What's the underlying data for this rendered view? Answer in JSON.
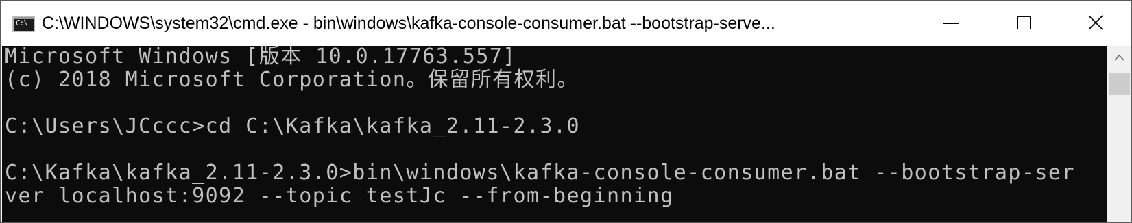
{
  "window": {
    "title": "C:\\WINDOWS\\system32\\cmd.exe - bin\\windows\\kafka-console-consumer.bat  --bootstrap-serve...",
    "icon_text": "C:\\",
    "icon": "cmd-icon",
    "buttons": {
      "minimize": "minimize-icon",
      "maximize": "maximize-icon",
      "close": "close-icon"
    }
  },
  "console": {
    "text_color": "#c0c0c0",
    "background": "#0c0c0c",
    "lines": [
      "Microsoft Windows [版本 10.0.17763.557]",
      "(c) 2018 Microsoft Corporation。保留所有权利。",
      "",
      "C:\\Users\\JCccc>cd C:\\Kafka\\kafka_2.11-2.3.0",
      "",
      "C:\\Kafka\\kafka_2.11-2.3.0>bin\\windows\\kafka-console-consumer.bat --bootstrap-ser",
      "ver localhost:9092 --topic testJc --from-beginning"
    ]
  },
  "scrollbar": {
    "up_arrow": "chevron-up-icon"
  }
}
